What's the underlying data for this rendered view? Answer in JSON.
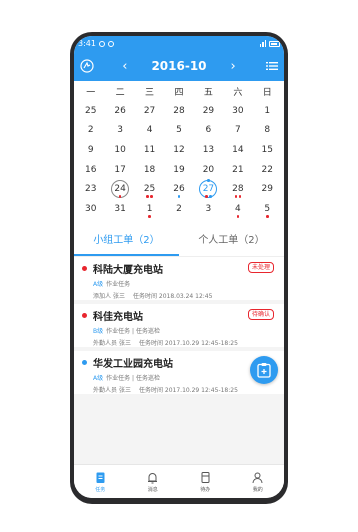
{
  "status": {
    "time": "3:41"
  },
  "header": {
    "month": "2016-10",
    "prev": "‹",
    "next": "›"
  },
  "weekdays": [
    "一",
    "二",
    "三",
    "四",
    "五",
    "六",
    "日"
  ],
  "calendar": [
    [
      {
        "d": "25"
      },
      {
        "d": "26"
      },
      {
        "d": "27"
      },
      {
        "d": "28"
      },
      {
        "d": "29"
      },
      {
        "d": "30"
      },
      {
        "d": "1"
      }
    ],
    [
      {
        "d": "2"
      },
      {
        "d": "3"
      },
      {
        "d": "4"
      },
      {
        "d": "5"
      },
      {
        "d": "6"
      },
      {
        "d": "7"
      },
      {
        "d": "8"
      }
    ],
    [
      {
        "d": "9"
      },
      {
        "d": "10"
      },
      {
        "d": "11"
      },
      {
        "d": "12"
      },
      {
        "d": "13"
      },
      {
        "d": "14"
      },
      {
        "d": "15"
      }
    ],
    [
      {
        "d": "16"
      },
      {
        "d": "17"
      },
      {
        "d": "18"
      },
      {
        "d": "19"
      },
      {
        "d": "20"
      },
      {
        "d": "21"
      },
      {
        "d": "22"
      }
    ],
    [
      {
        "d": "23"
      },
      {
        "d": "24",
        "today": true,
        "dots": [
          "red"
        ]
      },
      {
        "d": "25",
        "dots": [
          "red",
          "red"
        ]
      },
      {
        "d": "26",
        "dots": [
          "blue"
        ]
      },
      {
        "d": "27",
        "selected": true,
        "dots": [
          "red",
          "blue"
        ],
        "top": true
      },
      {
        "d": "28",
        "dots": [
          "red",
          "red"
        ]
      },
      {
        "d": "29"
      }
    ],
    [
      {
        "d": "30"
      },
      {
        "d": "31"
      },
      {
        "d": "1",
        "dots": [
          "red"
        ]
      },
      {
        "d": "2"
      },
      {
        "d": "3"
      },
      {
        "d": "4",
        "dots": [
          "red"
        ]
      },
      {
        "d": "5",
        "dots": [
          "red"
        ]
      }
    ]
  ],
  "tabs": {
    "group": "小组工单（2）",
    "personal": "个人工单（2）"
  },
  "orders": [
    {
      "title": "科陆大厦充电站",
      "dot": "#e8262e",
      "badge": "未处理",
      "level": "A级",
      "type": "作业任务",
      "person_label": "添加人",
      "person": "张三",
      "time_label": "任务时间",
      "time": "2018.03.24  12:45"
    },
    {
      "title": "科佳充电站",
      "dot": "#e8262e",
      "badge": "待确认",
      "level": "B级",
      "type": "作业任务  |  任务巡检",
      "person_label": "外勤人员",
      "person": "张三",
      "time_label": "任务时间",
      "time": "2017.10.29 12:45-18:25"
    },
    {
      "title": "华发工业园充电站",
      "dot": "#2e9bf0",
      "badge": "",
      "level": "A级",
      "type": "作业任务  |  任务巡检",
      "person_label": "外勤人员",
      "person": "张三",
      "time_label": "任务时间",
      "time": "2017.10.29 12:45-18:25"
    }
  ],
  "bottom_nav": [
    "任务",
    "消息",
    "待办",
    "我的"
  ],
  "colors": {
    "primary": "#2e9bf0",
    "alert": "#e8262e"
  }
}
